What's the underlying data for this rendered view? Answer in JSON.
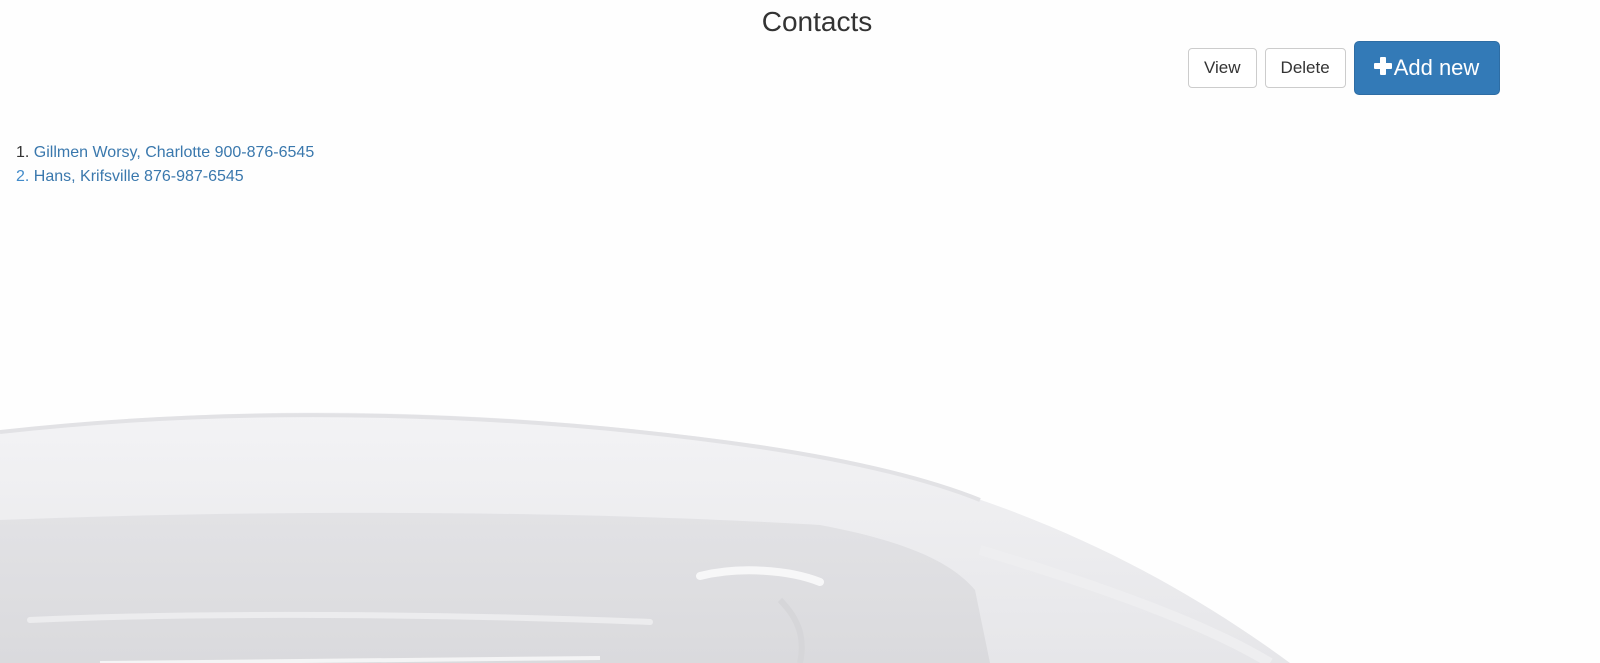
{
  "page": {
    "title": "Contacts"
  },
  "toolbar": {
    "view_label": "View",
    "delete_label": "Delete",
    "add_new_label": "Add new"
  },
  "contacts": [
    {
      "number": "1.",
      "text": "Gillmen Worsy, Charlotte 900-876-6545"
    },
    {
      "number": "2.",
      "text": "Hans, Krifsville 876-987-6545"
    }
  ],
  "colors": {
    "primary": "#337ab7",
    "link": "#3a78ad",
    "text": "#333333"
  },
  "icons": {
    "add": "plus-icon"
  }
}
